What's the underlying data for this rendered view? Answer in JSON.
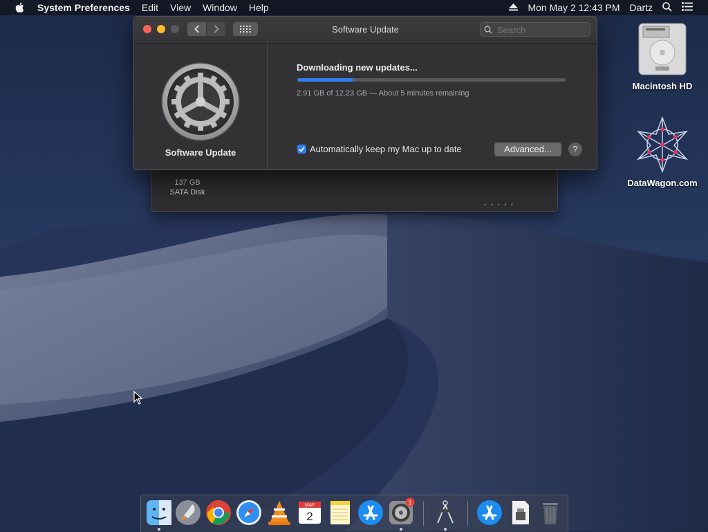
{
  "menubar": {
    "app_name": "System Preferences",
    "menus": [
      "Edit",
      "View",
      "Window",
      "Help"
    ],
    "datetime": "Mon May 2  12:43 PM",
    "user": "Dartz"
  },
  "window": {
    "title": "Software Update",
    "search_placeholder": "Search",
    "pane_label": "Software Update",
    "status_text": "Downloading new updates...",
    "progress_fraction": 0.21,
    "progress_detail": "2.91 GB of 12.23 GB — About 5 minutes remaining",
    "auto_update_label": "Automatically keep my Mac up to date",
    "auto_update_checked": true,
    "advanced_label": "Advanced...",
    "help_label": "?"
  },
  "back_window": {
    "disk_size": "137 GB",
    "disk_type": "SATA Disk"
  },
  "desktop_icons": [
    {
      "label": "Macintosh HD",
      "icon": "hard-drive-icon"
    },
    {
      "label": "DataWagon.com",
      "icon": "datawagon-logo-icon"
    }
  ],
  "dock": {
    "items": [
      "finder",
      "launchpad",
      "chrome",
      "safari",
      "vlc",
      "calendar",
      "notes",
      "app-store",
      "system-preferences",
      "instruments",
      "app-store-2",
      "preview",
      "trash"
    ],
    "calendar_month": "MAY",
    "calendar_day": "2",
    "badge_count": "1"
  },
  "colors": {
    "accent": "#2f7df0",
    "close": "#fc5f57",
    "minimize": "#fdbc2e"
  }
}
